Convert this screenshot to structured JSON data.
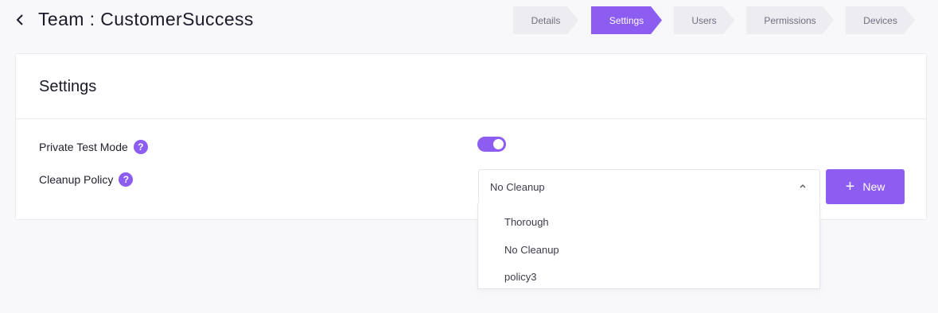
{
  "header": {
    "title": "Team : CustomerSuccess"
  },
  "steps": [
    {
      "label": "Details",
      "active": false
    },
    {
      "label": "Settings",
      "active": true
    },
    {
      "label": "Users",
      "active": false
    },
    {
      "label": "Permissions",
      "active": false
    },
    {
      "label": "Devices",
      "active": false
    }
  ],
  "settings": {
    "title": "Settings",
    "private_test_mode": {
      "label": "Private Test Mode",
      "enabled": true
    },
    "cleanup_policy": {
      "label": "Cleanup Policy",
      "selected": "No Cleanup",
      "options": [
        "Thorough",
        "No Cleanup",
        "policy3"
      ]
    },
    "new_button_label": "New"
  },
  "icons": {
    "back": "chevron-left-icon",
    "help": "question-mark-icon",
    "select_toggle": "chevron-up-icon",
    "add": "plus-icon"
  },
  "colors": {
    "accent": "#8d5cf1",
    "step_inactive": "#ececf1",
    "background": "#f8f8fb"
  }
}
